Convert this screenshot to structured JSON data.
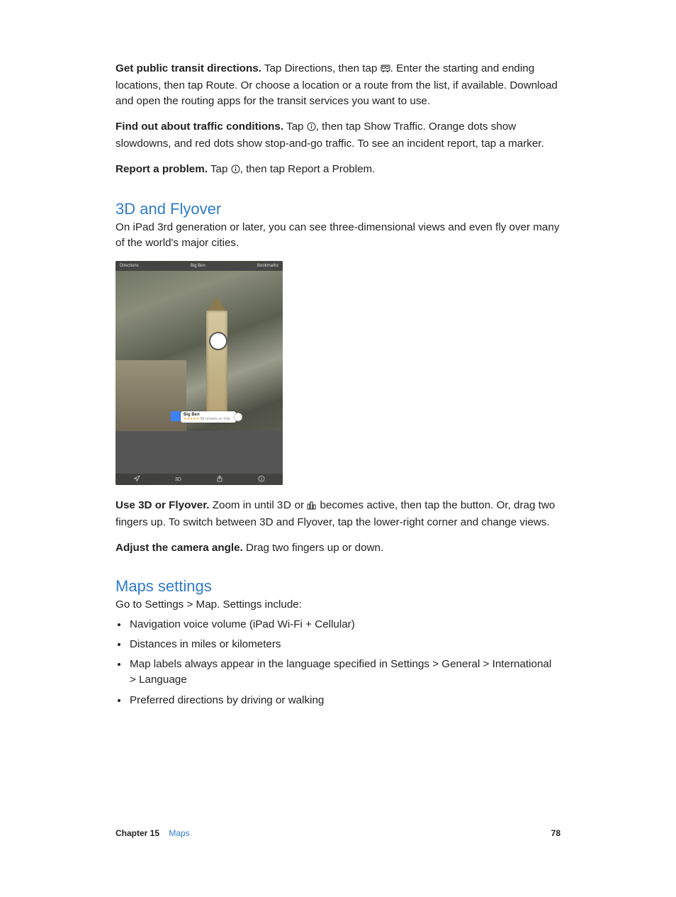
{
  "para1": {
    "bold": "Get public transit directions.",
    "text": " Tap Directions, then tap ",
    "after_icon": ". Enter the starting and ending locations, then tap Route. Or choose a location or a route from the list, if available. Download and open the routing apps for the transit services you want to use."
  },
  "para2": {
    "bold": "Find out about traffic conditions.",
    "text": " Tap ",
    "after_icon": ", then tap Show Traffic. Orange dots show slowdowns, and red dots show stop-and-go traffic. To see an incident report, tap a marker."
  },
  "para3": {
    "bold": "Report a problem.",
    "text": " Tap ",
    "after_icon": ", then tap Report a Problem."
  },
  "h2_1": "3D and Flyover",
  "para4": "On iPad 3rd generation or later, you can see three-dimensional views and even fly over many of the world's major cities.",
  "screenshot": {
    "top_left": "Directions",
    "top_mid": "Big Ben",
    "top_right": "Bookmarks",
    "pin_title": "Big Ben",
    "pin_sub": "85 reviews on Yelp"
  },
  "para5": {
    "bold": "Use 3D or Flyover.",
    "text": " Zoom in until ",
    "mid": " or ",
    "after": " becomes active, then tap the button. Or, drag two fingers up. To switch between 3D and Flyover, tap the lower-right corner and change views."
  },
  "icon_3d_label": "3D",
  "para6": {
    "bold": "Adjust the camera angle.",
    "text": " Drag two fingers up or down."
  },
  "h2_2": "Maps settings",
  "para7": "Go to Settings > Map. Settings include:",
  "list": [
    "Navigation voice volume (iPad Wi-Fi + Cellular)",
    "Distances in miles or kilometers",
    "Map labels always appear in the language specified in Settings > General > International > Language",
    "Preferred directions by driving or walking"
  ],
  "footer": {
    "chapter_label": "Chapter  15",
    "chapter_name": "Maps",
    "page": "78"
  }
}
